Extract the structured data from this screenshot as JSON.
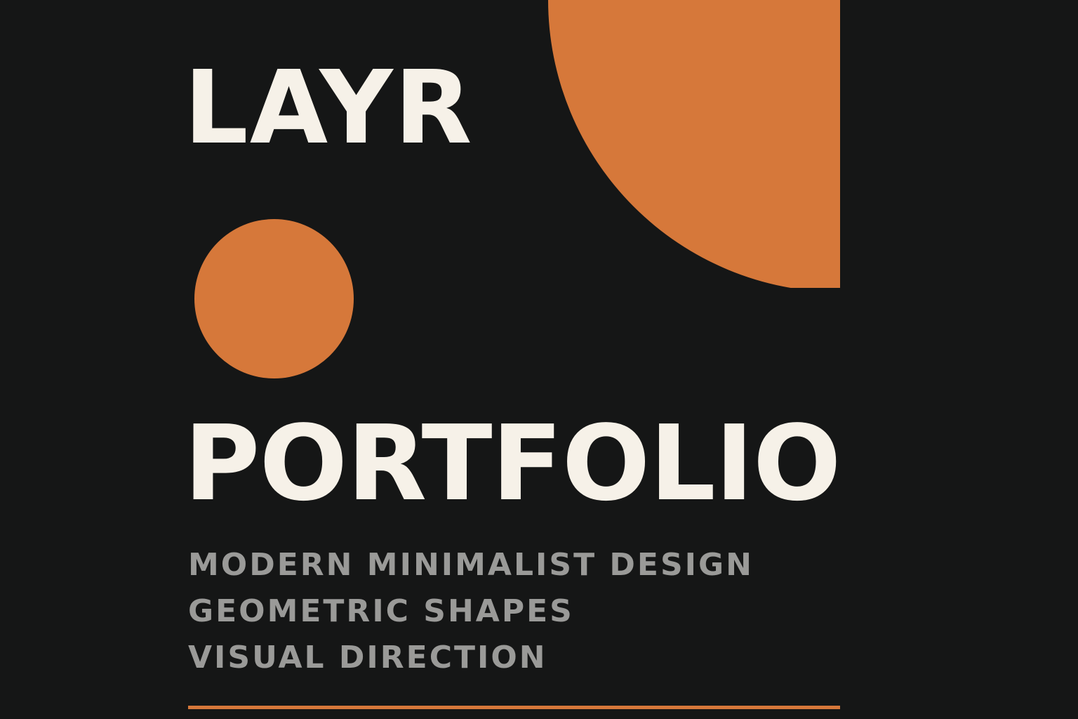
{
  "brand": "LAYR",
  "title": "PORTFOLIO",
  "taglines": [
    "MODERN MINIMALIST DESIGN",
    "GEOMETRIC SHAPES",
    "VISUAL DIRECTION"
  ],
  "colors": {
    "background": "#151616",
    "accent": "#d6783a",
    "heading": "#f6f1e8",
    "tagline": "#9a9a98"
  }
}
